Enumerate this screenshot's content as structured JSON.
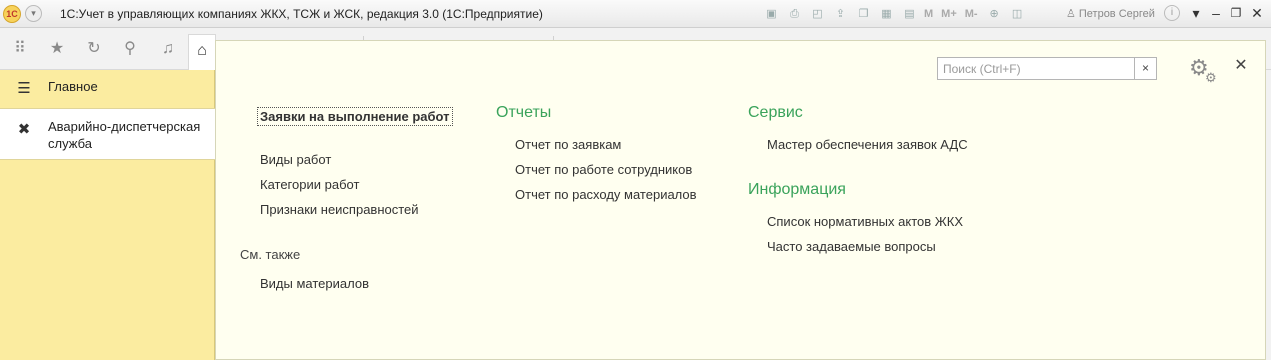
{
  "window": {
    "logo_text": "1С",
    "menu_glyph": "▾",
    "title": "1С:Учет в управляющих компаниях ЖКХ, ТСЖ и ЖСК, редакция 3.0  (1С:Предприятие)",
    "toolbar_m": "M",
    "toolbar_m_plus": "M+",
    "toolbar_m_minus": "M-",
    "user": "Петров Сергей"
  },
  "sidebar": {
    "items": [
      {
        "label": "Главное",
        "icon": "menu-lines-icon"
      },
      {
        "label": "Аварийно-диспетчерская служба",
        "icon": "wrench-screwdriver-icon",
        "active": true
      }
    ]
  },
  "search": {
    "placeholder": "Поиск (Ctrl+F)",
    "value": "",
    "clear": "×"
  },
  "main": {
    "col1": {
      "primary": "Заявки на выполнение работ",
      "links": [
        "Виды работ",
        "Категории работ",
        "Признаки неисправностей"
      ],
      "see_also_title": "См. также",
      "see_also": [
        "Виды материалов"
      ]
    },
    "reports": {
      "title": "Отчеты",
      "links": [
        "Отчет по заявкам",
        "Отчет по работе сотрудников",
        "Отчет по расходу материалов"
      ]
    },
    "service": {
      "title": "Сервис",
      "links": [
        "Мастер обеспечения заявок АДС"
      ]
    },
    "info": {
      "title": "Информация",
      "links": [
        "Список нормативных актов ЖКХ",
        "Часто задаваемые вопросы"
      ]
    }
  },
  "colors": {
    "sidebar_bg": "#fbeca0",
    "panel_bg": "#fffff0",
    "section_heading": "#3aa35b"
  }
}
